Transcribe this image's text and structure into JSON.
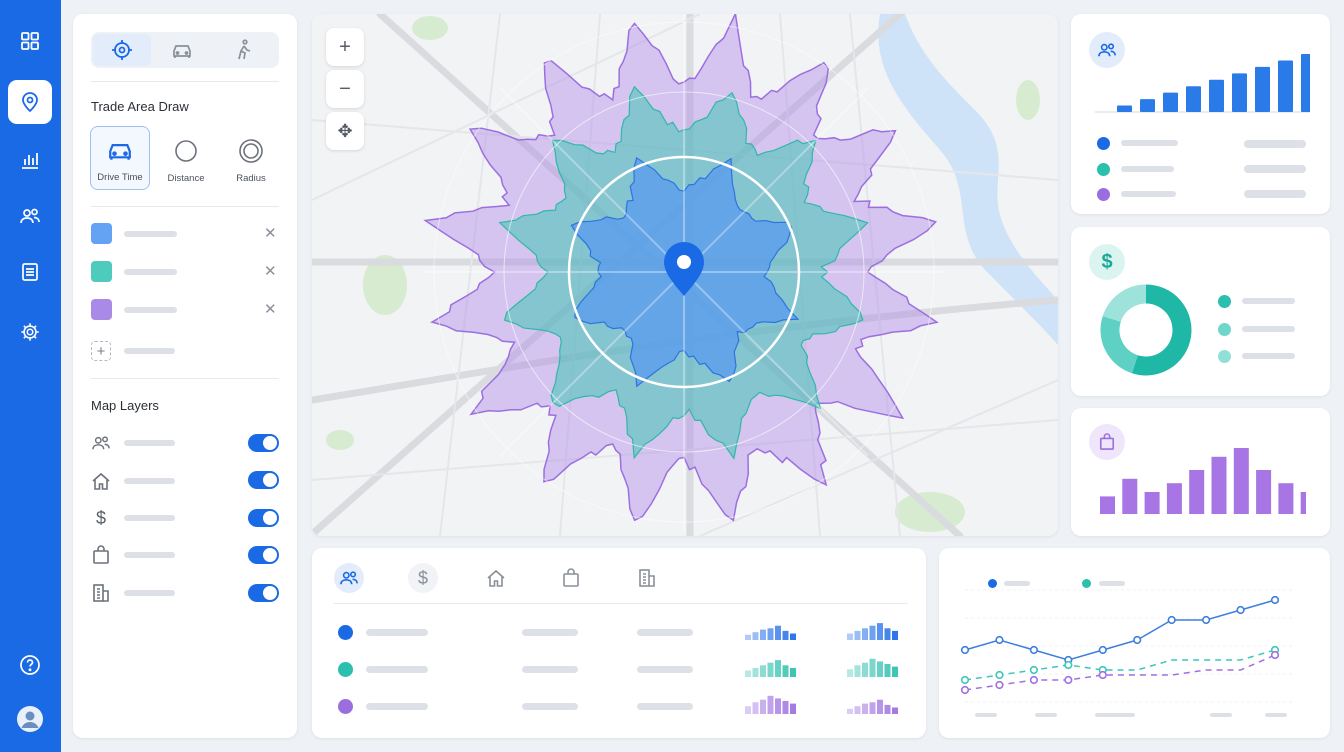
{
  "sidebar_nav": {
    "items": [
      {
        "icon": "grid-icon"
      },
      {
        "icon": "map-pin-icon",
        "active": true
      },
      {
        "icon": "bar-chart-icon"
      },
      {
        "icon": "users-icon"
      },
      {
        "icon": "document-icon"
      },
      {
        "icon": "settings-icon"
      }
    ],
    "bottom": [
      {
        "icon": "help-icon"
      },
      {
        "icon": "user-avatar-icon"
      }
    ]
  },
  "panel": {
    "tabs": [
      {
        "icon": "crosshair-icon",
        "selected": true
      },
      {
        "icon": "car-icon"
      },
      {
        "icon": "walking-icon"
      }
    ],
    "trade_area_title": "Trade Area Draw",
    "modes": [
      {
        "label": "Drive Time",
        "icon": "car-icon",
        "selected": true
      },
      {
        "label": "Distance",
        "icon": "circle-icon"
      },
      {
        "label": "Radius",
        "icon": "radius-icon"
      }
    ],
    "areas": [
      {
        "color": "#64a2f4"
      },
      {
        "color": "#4ecbbd"
      },
      {
        "color": "#a98ae6"
      }
    ],
    "close_glyph": "✕",
    "add_glyph": "+",
    "map_layers_title": "Map Layers",
    "layers": [
      {
        "icon": "people-icon",
        "on": true
      },
      {
        "icon": "home-icon",
        "on": true
      },
      {
        "icon": "dollar-icon",
        "on": true
      },
      {
        "icon": "shopping-bag-icon",
        "on": true
      },
      {
        "icon": "building-icon",
        "on": true
      }
    ]
  },
  "map": {
    "zoom_in": "+",
    "zoom_out": "−",
    "pan_glyph": "✥",
    "colors": {
      "inner": "#5a9aef",
      "middle": "#43c6b6",
      "outer": "#b08be8",
      "pin": "#1a6ae6"
    }
  },
  "colors": {
    "blue": "#1a6ae6",
    "teal": "#2bbfae",
    "purple": "#9b6ee0"
  },
  "demographics_chart": {
    "values": [
      1,
      2,
      3,
      4,
      5,
      6,
      7,
      8,
      9
    ]
  },
  "donut": {
    "segments": [
      0.55,
      0.25,
      0.2
    ]
  },
  "spend_chart": {
    "values": [
      4,
      8,
      5,
      7,
      10,
      13,
      15,
      10,
      7,
      5
    ]
  },
  "bottom_table": {
    "tabs": [
      {
        "icon": "people-icon",
        "selected": true
      },
      {
        "icon": "dollar-icon"
      },
      {
        "icon": "home-icon"
      },
      {
        "icon": "shopping-bag-icon"
      },
      {
        "icon": "building-icon"
      }
    ],
    "rows": [
      {
        "color": "#1a6ae6"
      },
      {
        "color": "#2bbfae"
      },
      {
        "color": "#9b6ee0"
      }
    ]
  },
  "chart_data": {
    "type": "line",
    "series": [
      {
        "values": [
          5,
          6,
          5,
          4,
          5,
          6,
          8,
          8,
          9,
          10
        ]
      },
      {
        "values": [
          2,
          2.5,
          3,
          3.5,
          3,
          3,
          4,
          4,
          4,
          5
        ]
      },
      {
        "values": [
          1,
          1.5,
          2,
          2,
          2.5,
          2.5,
          2.5,
          3,
          3,
          4.5
        ]
      }
    ]
  }
}
